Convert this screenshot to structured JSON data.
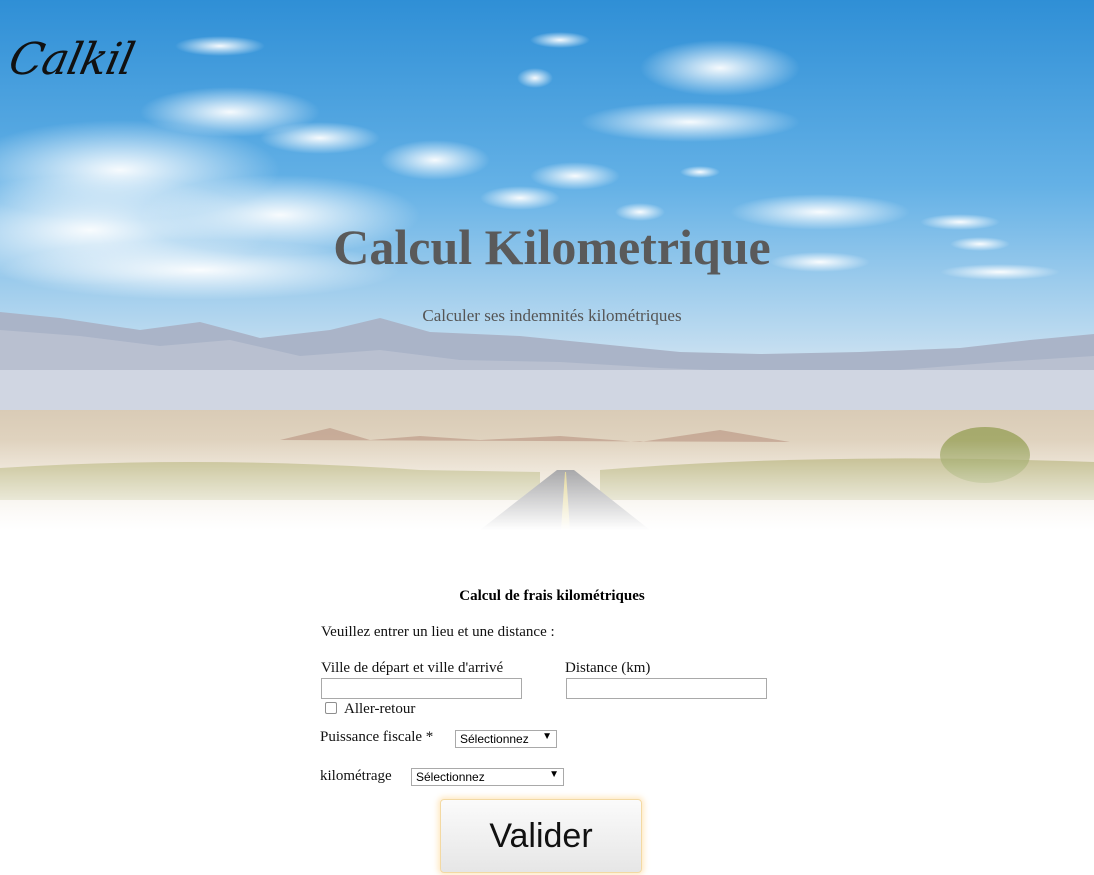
{
  "brand": {
    "logo": "Calkil"
  },
  "hero": {
    "title": "Calcul Kilometrique",
    "subtitle": "Calculer ses indemnités kilométriques"
  },
  "form": {
    "heading": "Calcul de frais kilométriques",
    "intro": "Veuillez entrer un lieu et une distance :",
    "ville_label": "Ville de départ et ville d'arrivé",
    "ville_value": "",
    "distance_label": "Distance (km)",
    "distance_value": "",
    "aller_retour_label": "Aller-retour",
    "aller_retour_checked": false,
    "puissance_label": "Puissance fiscale *",
    "puissance_selected": "Sélectionnez",
    "kilometrage_label": "kilométrage",
    "kilometrage_selected": "Sélectionnez",
    "submit_label": "Valider"
  }
}
